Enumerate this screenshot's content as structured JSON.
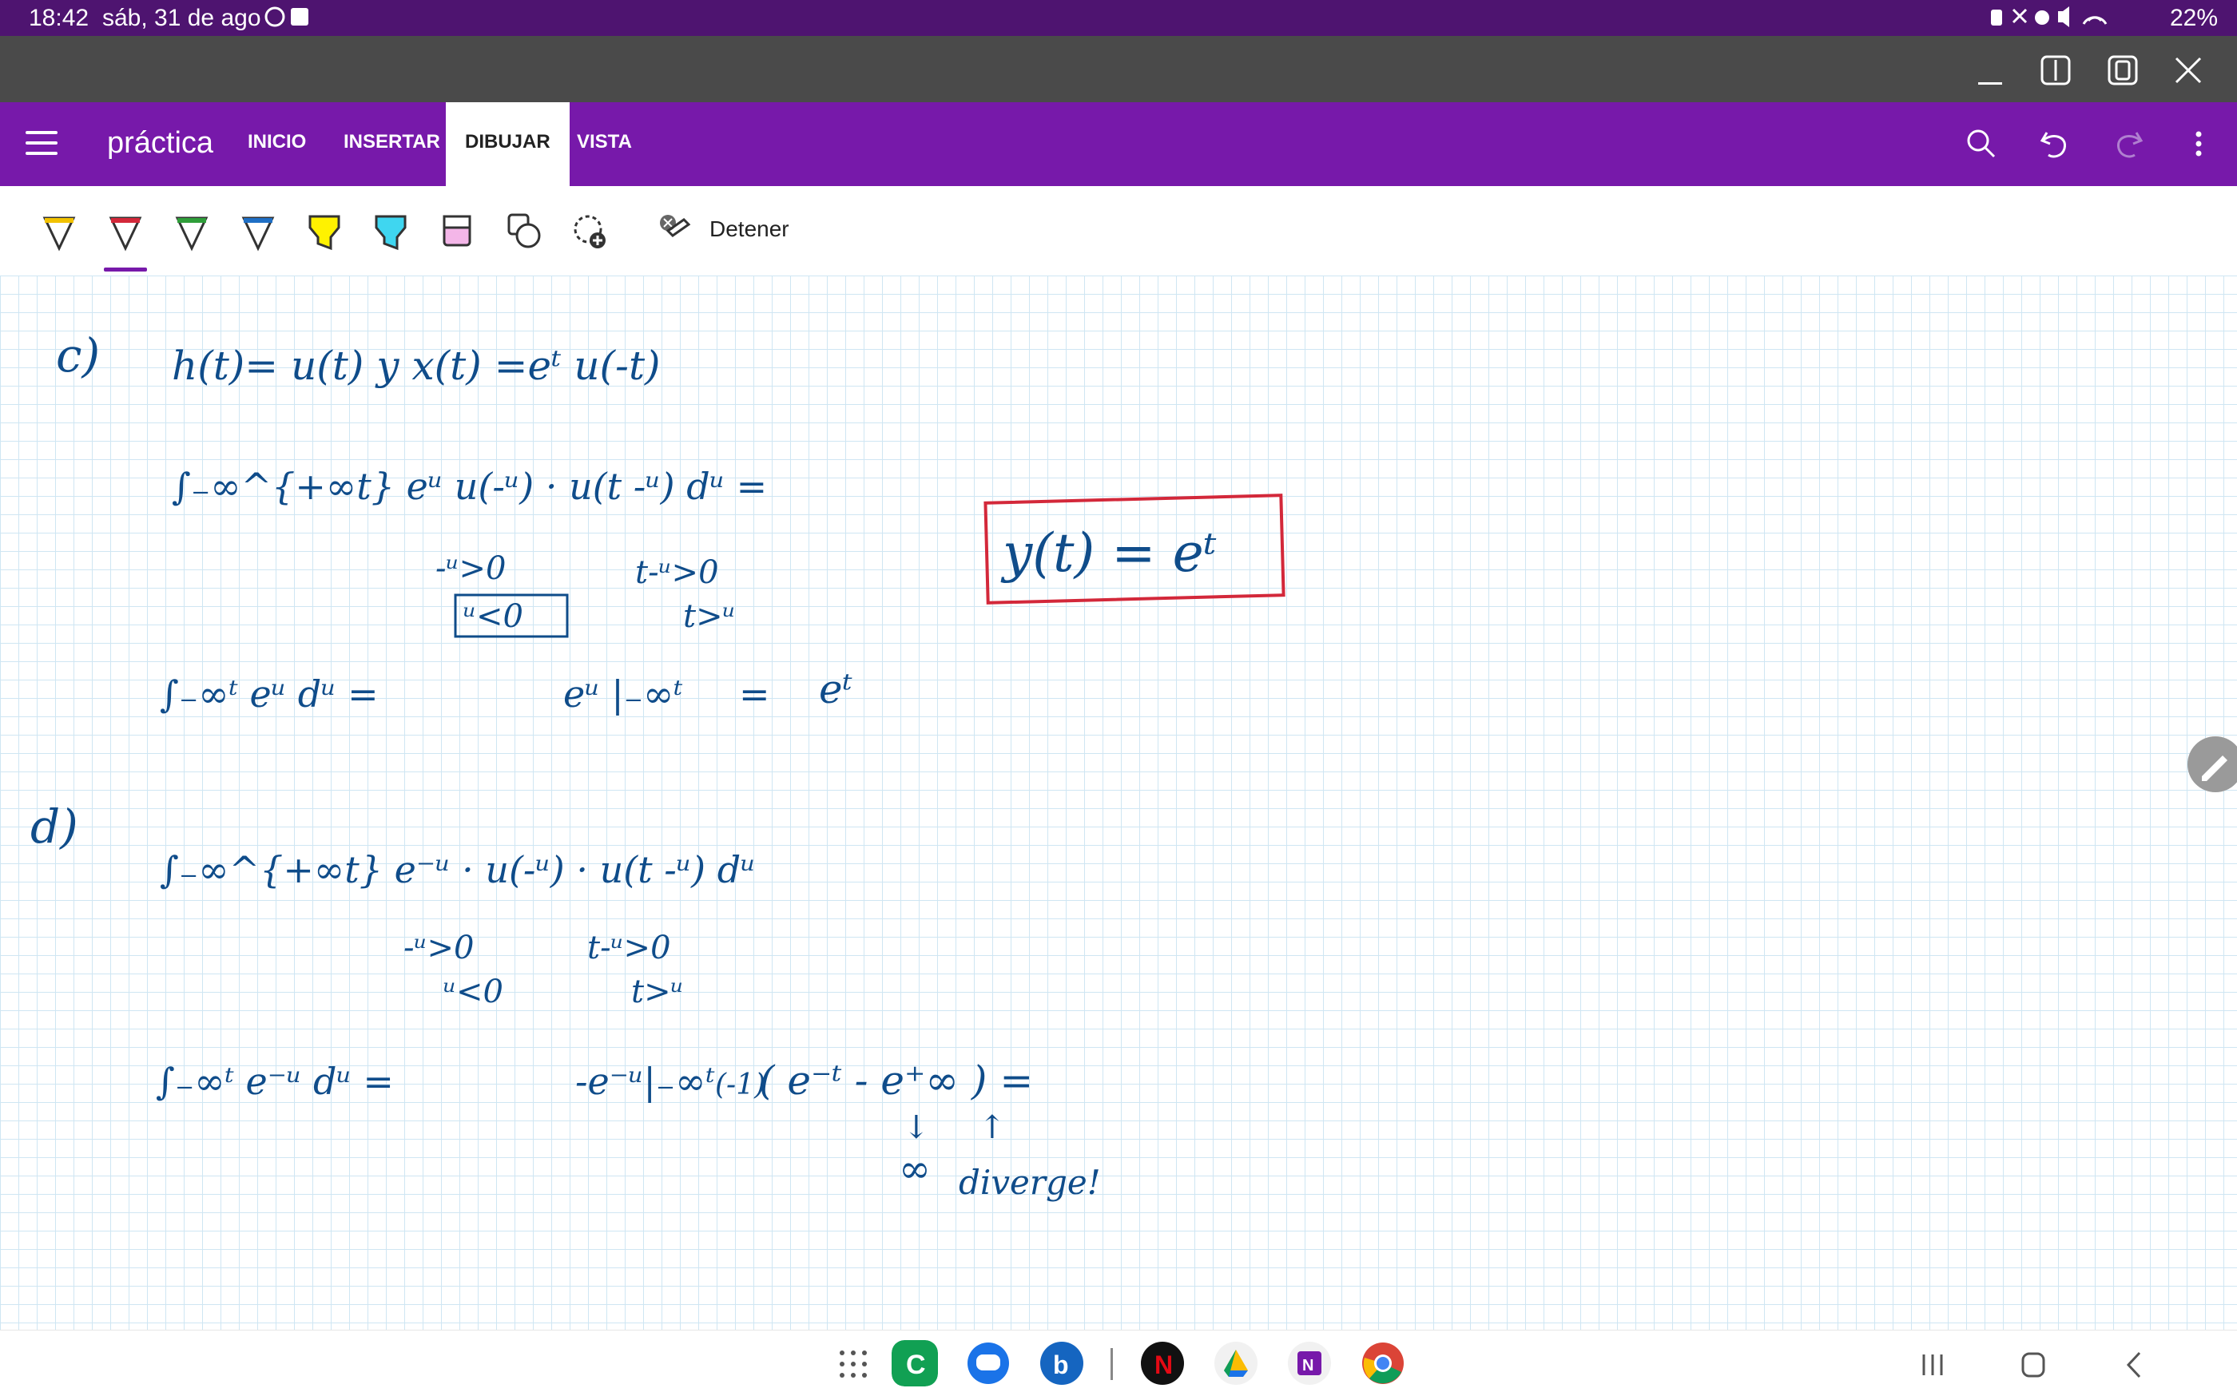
{
  "status_bar": {
    "time": "18:42",
    "date": "sáb, 31 de ago",
    "battery": "22%"
  },
  "window_controls": [
    "minimize-icon",
    "split-view-icon",
    "pop-out-icon",
    "close-icon"
  ],
  "ribbon": {
    "title": "práctica",
    "tabs": [
      {
        "label": "INICIO",
        "active": false
      },
      {
        "label": "INSERTAR",
        "active": false
      },
      {
        "label": "DIBUJAR",
        "active": true
      },
      {
        "label": "VISTA",
        "active": false
      }
    ],
    "actions": [
      "search-icon",
      "undo-icon",
      "redo-icon",
      "more-options-icon"
    ]
  },
  "toolbar": {
    "pens": [
      {
        "name": "pen-yellow",
        "color": "#f2c200"
      },
      {
        "name": "pen-red",
        "color": "#d3283a",
        "selected": true
      },
      {
        "name": "pen-green",
        "color": "#2f9e3a"
      },
      {
        "name": "pen-blue",
        "color": "#1f6fc5"
      },
      {
        "name": "highlighter-yellow",
        "color": "#fff200"
      },
      {
        "name": "highlighter-cyan",
        "color": "#3fd6f0"
      },
      {
        "name": "highlighter-pink",
        "color": "#f4b6e8"
      }
    ],
    "stop_label": "Detener"
  },
  "notes": {
    "c": {
      "label": "c)",
      "line1": "h(t)= u(t) y   x(t) =eᵗ u(-t)",
      "line2": "∫₋∞^{+∞t} eᵘ u(-ᵘ) · u(t -ᵘ) dᵘ =",
      "cond_left_1": "-ᵘ>0",
      "cond_left_2": "ᵘ<0",
      "cond_right_1": "t-ᵘ>0",
      "cond_right_2": "t>ᵘ",
      "line3_int": "∫₋∞ᵗ  eᵘ   dᵘ =",
      "line3_eval": "eᵘ |₋∞ᵗ",
      "line3_eq": "=",
      "line3_result": "eᵗ",
      "answer_box": "y(t) = eᵗ"
    },
    "d": {
      "label": "d)",
      "line1": "∫₋∞^{+∞t}  e⁻ᵘ · u(-ᵘ) · u(t -ᵘ) dᵘ",
      "cond_left_1": "-ᵘ>0",
      "cond_left_2": "ᵘ<0",
      "cond_right_1": "t-ᵘ>0",
      "cond_right_2": "t>ᵘ",
      "line2_int": "∫₋∞ᵗ   e⁻ᵘ  dᵘ =",
      "line2_eval": "-e⁻ᵘ|₋∞ᵗ",
      "line2_mult": "(-1)",
      "line2_paren": "( e⁻ᵗ - e⁺∞ ) =",
      "arrow_left": "↓",
      "arrow_right": "↑",
      "infinity": "∞",
      "diverge": "diverge!"
    }
  },
  "dock": [
    "app-c",
    "messages",
    "bixby",
    "netflix",
    "drive",
    "onenote",
    "chrome"
  ],
  "nav": [
    "recents-icon",
    "home-icon",
    "back-icon"
  ]
}
